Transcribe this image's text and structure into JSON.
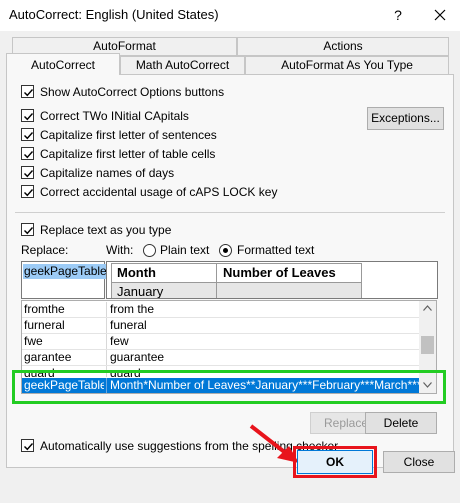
{
  "window": {
    "title": "AutoCorrect: English (United States)",
    "help": "?",
    "close_glyph": "close-icon"
  },
  "tabs": {
    "row_top": [
      "AutoFormat",
      "Actions"
    ],
    "row_bottom": [
      "AutoCorrect",
      "Math AutoCorrect",
      "AutoFormat As You Type"
    ],
    "active": "AutoCorrect"
  },
  "options": [
    {
      "label": "Show AutoCorrect Options buttons",
      "checked": true
    },
    {
      "label": "Correct TWo INitial CApitals",
      "checked": true
    },
    {
      "label": "Capitalize first letter of sentences",
      "checked": true
    },
    {
      "label": "Capitalize first letter of table cells",
      "checked": true
    },
    {
      "label": "Capitalize names of days",
      "checked": true
    },
    {
      "label": "Correct accidental usage of cAPS LOCK key",
      "checked": true
    }
  ],
  "exceptions_label": "Exceptions...",
  "replace_section": {
    "checkbox_label": "Replace text as you type",
    "checked": true,
    "replace_label": "Replace:",
    "with_label": "With:",
    "plain_text_label": "Plain text",
    "formatted_text_label": "Formatted text",
    "selected_option": "Formatted text",
    "replace_value": "geekPageTable",
    "preview_table": {
      "headers": [
        "Month",
        "Number of Leaves"
      ],
      "first_cell": "January"
    }
  },
  "entries": [
    {
      "replace": "fromthe",
      "with": "from the"
    },
    {
      "replace": "furneral",
      "with": "funeral"
    },
    {
      "replace": "fwe",
      "with": "few"
    },
    {
      "replace": "garantee",
      "with": "guarantee"
    },
    {
      "replace": "guard",
      "with": "guard"
    },
    {
      "replace": "geekPageTable",
      "with": "Month*Number of Leaves**January***February***March***A",
      "selected": true
    }
  ],
  "buttons": {
    "replace": "Replace",
    "delete": "Delete",
    "ok": "OK",
    "close": "Close"
  },
  "spelling_option": {
    "label": "Automatically use suggestions from the spelling checker",
    "checked": true
  },
  "colors": {
    "accent": "#0078d7",
    "highlight": "#22cc22",
    "annotation": "#e8141c"
  }
}
